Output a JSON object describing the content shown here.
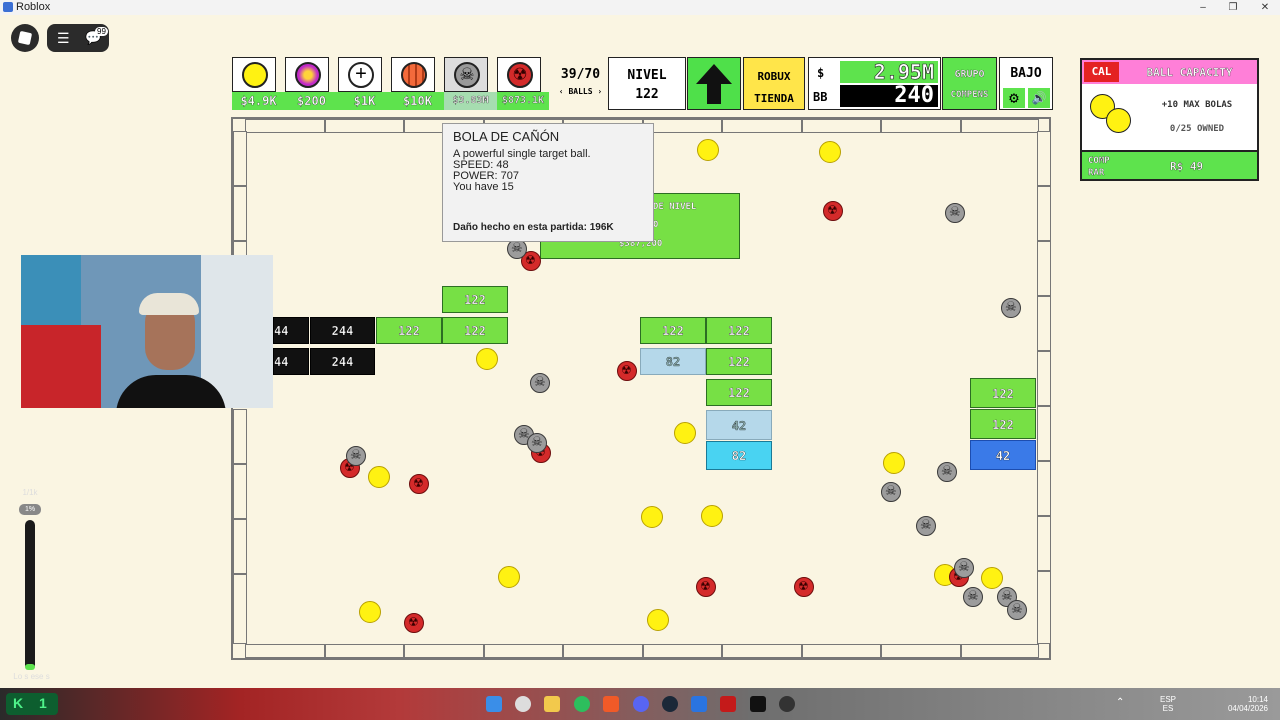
{
  "window": {
    "title": "Roblox",
    "minimize": "–",
    "maximize": "❐",
    "close": "✕"
  },
  "topleft": {
    "notif_count": "99"
  },
  "shop": {
    "prices": [
      "$4.9K",
      "$200",
      "$1K",
      "$10K",
      "$3.83M",
      "$873.1K"
    ],
    "ball_icons": [
      "yellow-ball-icon",
      "purple-ball-icon",
      "plus-ball-icon",
      "orange-striped-ball-icon",
      "skull-ball-icon",
      "radiation-ball-icon"
    ]
  },
  "balls_counter": {
    "value": "39/70",
    "label": "BALLS",
    "prev": "‹",
    "next": "›"
  },
  "level": {
    "label": "NIVEL",
    "value": "122"
  },
  "robux_shop": {
    "line1": "ROBUX",
    "line2": "TIENDA"
  },
  "currency": {
    "money_symbol": "$",
    "money_value": "2.95M",
    "bb_label": "BB",
    "bb_value": "240"
  },
  "group": {
    "line1": "GRUPO",
    "line2": "COMPENS"
  },
  "low_button": "BAJO",
  "capacity_card": {
    "tab": "CAL",
    "title": "BALL CAPACITY",
    "line1": "+10 MAX BOLAS",
    "line2": "0/25 OWNED",
    "buy_label_1": "COMP",
    "buy_label_2": "RAR",
    "price": "R$ 49"
  },
  "tooltip": {
    "title": "BOLA DE CAÑÓN",
    "desc": "A powerful single target ball.",
    "speed": "SPEED: 48",
    "power": "POWER: 707",
    "have": "You have 15",
    "damage": "Daño hecho en esta partida: 196K"
  },
  "level_up_block": {
    "title": "DE NIVEL",
    "line2": "0",
    "price": "$387,200"
  },
  "bricks": {
    "b1": "122",
    "b2": "244",
    "b3": "122",
    "b4": "122",
    "b5": "244",
    "b6": "44",
    "b7": "44",
    "b8": "122",
    "b9": "122",
    "b10": "82",
    "b11": "122",
    "b12": "122",
    "b13": "42",
    "b14": "82",
    "b15": "122",
    "b16": "122",
    "b17": "42"
  },
  "side_meter": {
    "label": "1/1k",
    "percent": "1%",
    "fill_fraction": 0.01,
    "bottom": "Lo s ese s"
  },
  "taskbar": {
    "lang1": "ESP",
    "lang2": "ES",
    "time": "10:14",
    "date": "04/04/2026",
    "k_label": "1"
  },
  "colors": {
    "green": "#77e045",
    "yellow": "#fff212",
    "red_ball": "#d42a2a",
    "pink_header": "#ff7fd8"
  }
}
